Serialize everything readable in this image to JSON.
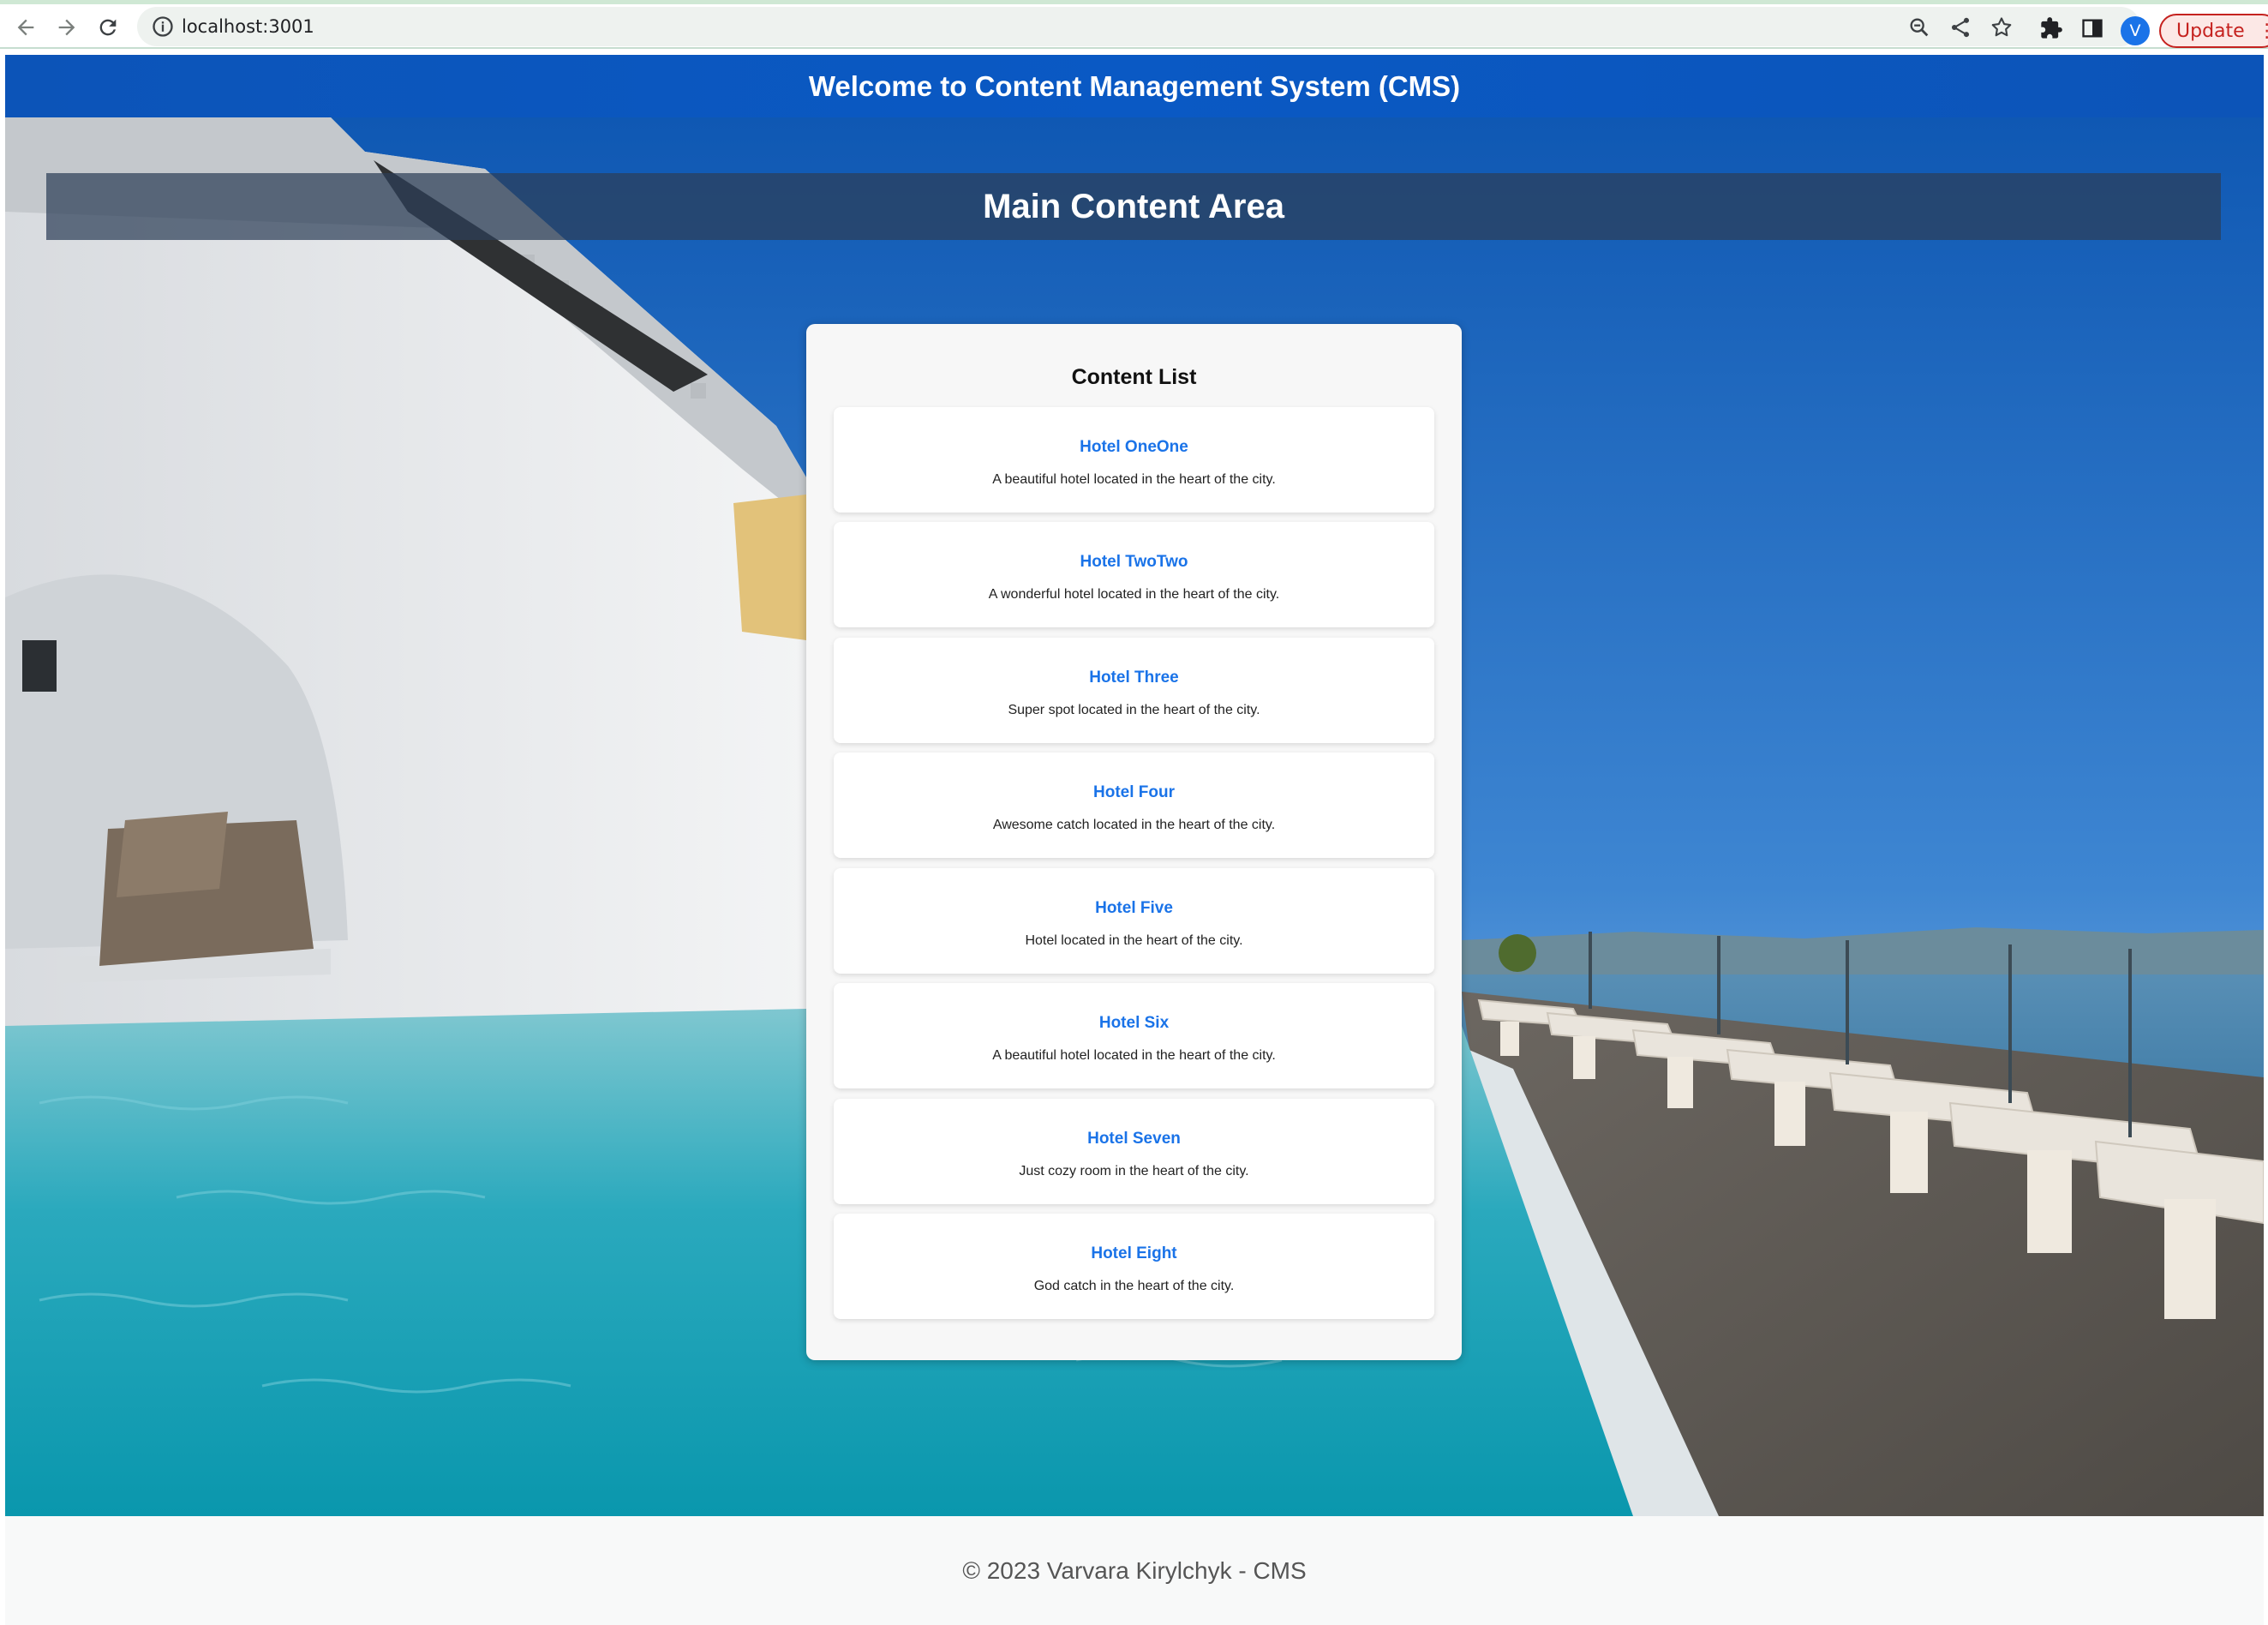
{
  "browser": {
    "url": "localhost:3001",
    "avatar_letter": "V",
    "update_label": "Update",
    "icons": [
      "back-arrow-icon",
      "forward-arrow-icon",
      "reload-icon",
      "info-icon",
      "zoom-icon",
      "share-icon",
      "star-icon",
      "extensions-icon",
      "side-panel-icon",
      "more-vert-icon"
    ]
  },
  "header": {
    "title": "Welcome to Content Management System (CMS)"
  },
  "main": {
    "title": "Main Content Area",
    "list_title": "Content List",
    "items": [
      {
        "title": "Hotel OneOne",
        "description": "A beautiful hotel located in the heart of the city."
      },
      {
        "title": "Hotel TwoTwo",
        "description": "A wonderful hotel located in the heart of the city."
      },
      {
        "title": "Hotel Three",
        "description": "Super spot located in the heart of the city."
      },
      {
        "title": "Hotel Four",
        "description": "Awesome catch located in the heart of the city."
      },
      {
        "title": "Hotel Five",
        "description": "Hotel located in the heart of the city."
      },
      {
        "title": "Hotel Six",
        "description": "A beautiful hotel located in the heart of the city."
      },
      {
        "title": "Hotel Seven",
        "description": "Just cozy room in the heart of the city."
      },
      {
        "title": "Hotel Eight",
        "description": "God catch in the heart of the city."
      }
    ]
  },
  "footer": {
    "copyright": "© 2023 Varvara Kirylchyk - CMS"
  },
  "colors": {
    "header_bg": "#0a59c4",
    "item_title": "#1a73e8",
    "title_bar": "#2c3e58"
  }
}
